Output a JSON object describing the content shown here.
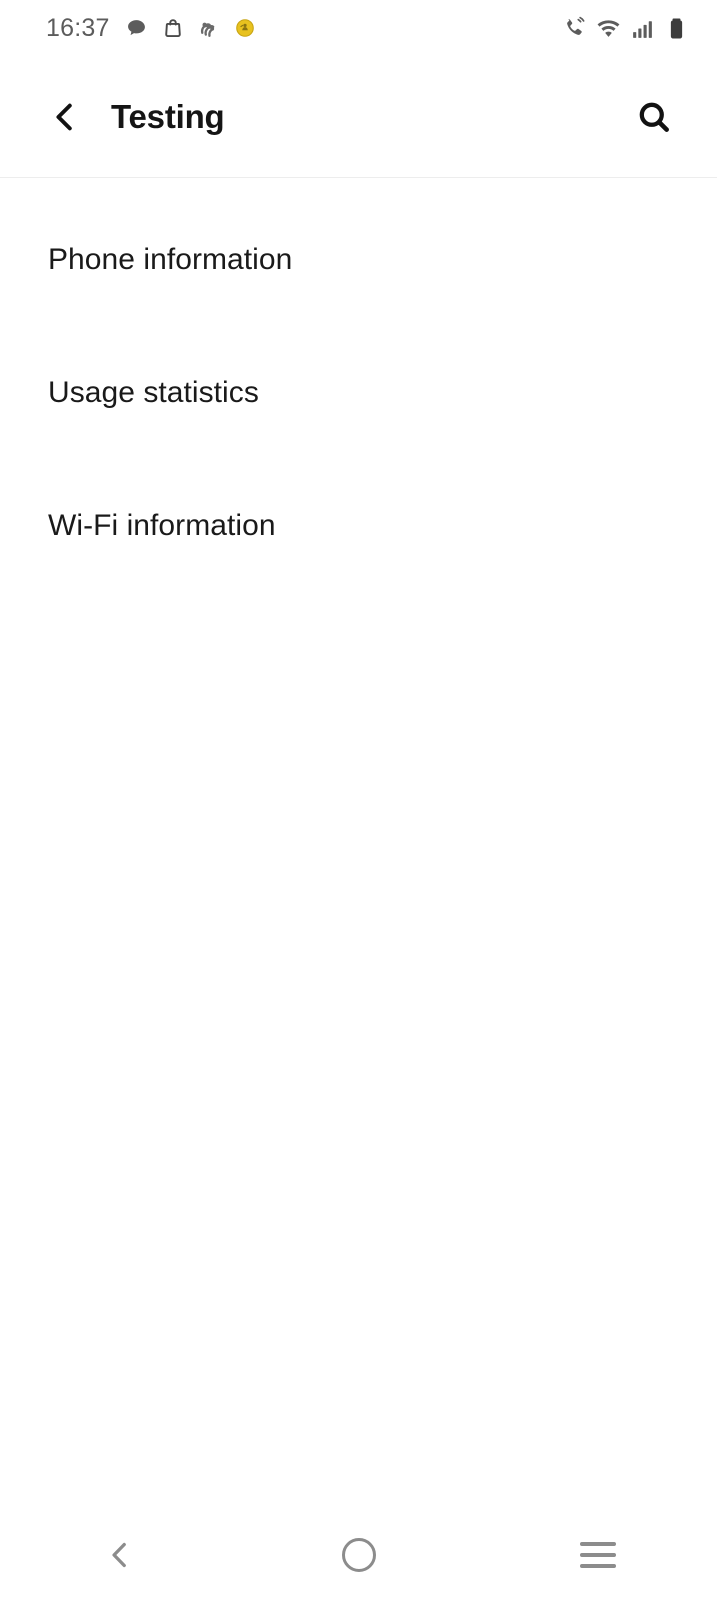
{
  "status_bar": {
    "time": "16:37",
    "notification_icons": [
      {
        "name": "message-bubble-icon",
        "color": "#5c5c5c"
      },
      {
        "name": "shopping-bag-icon",
        "color": "#4a4a4a"
      },
      {
        "name": "app-notification-icon",
        "color": "#6a6a6a"
      },
      {
        "name": "coin-badge-icon",
        "color": "#e8c21f"
      }
    ],
    "system_icons": [
      {
        "name": "call-vibrate-icon",
        "color": "#5c5c5c"
      },
      {
        "name": "wifi-icon",
        "color": "#5c5c5c"
      },
      {
        "name": "cellular-signal-icon",
        "color": "#5c5c5c"
      },
      {
        "name": "battery-icon",
        "color": "#3d3d3d"
      }
    ]
  },
  "app_bar": {
    "title": "Testing",
    "back_label": "Back",
    "search_label": "Search"
  },
  "main": {
    "items": [
      {
        "label": "Phone information"
      },
      {
        "label": "Usage statistics"
      },
      {
        "label": "Wi-Fi information"
      }
    ]
  },
  "nav_bar": {
    "back_label": "Back",
    "home_label": "Home",
    "recents_label": "Recents"
  },
  "colors": {
    "background": "#ffffff",
    "primary_text": "#1a1a1a",
    "secondary_text": "#5c5c5c",
    "divider": "#ededed",
    "nav_icon": "#8c8c8c",
    "accent_yellow": "#e8c21f"
  }
}
